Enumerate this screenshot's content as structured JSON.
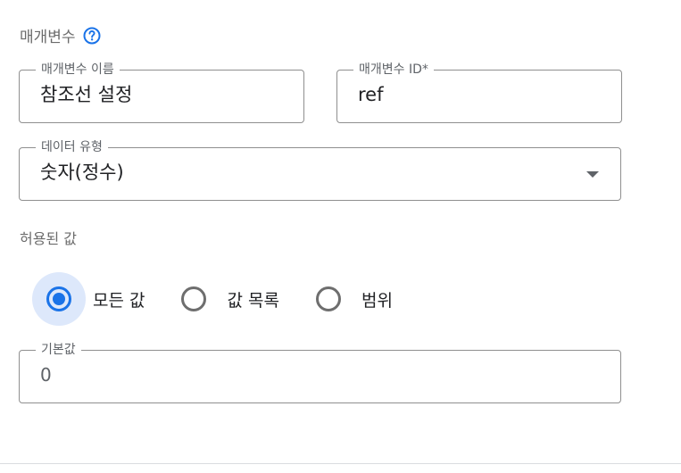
{
  "section": {
    "title": "매개변수",
    "help_icon": "help-circle-icon"
  },
  "fields": {
    "name": {
      "label": "매개변수 이름",
      "value": "참조선 설정"
    },
    "id": {
      "label": "매개변수 ID*",
      "value": "ref"
    },
    "data_type": {
      "label": "데이터 유형",
      "value": "숫자(정수)",
      "icon": "dropdown-arrow-icon"
    },
    "default": {
      "label": "기본값",
      "value": "0"
    }
  },
  "allowed_values": {
    "title": "허용된 값",
    "options": [
      {
        "label": "모든 값",
        "selected": true
      },
      {
        "label": "값 목록",
        "selected": false
      },
      {
        "label": "범위",
        "selected": false
      }
    ]
  },
  "colors": {
    "accent": "#1a73e8",
    "selected_halo": "#dde8fb",
    "border": "#8f8f8f",
    "muted_text": "#6b6b6b"
  }
}
